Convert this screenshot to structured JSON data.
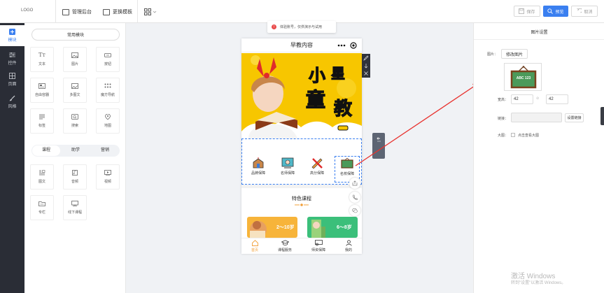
{
  "topbar": {
    "logo": "LOGO",
    "nav": [
      {
        "label": "管理后台",
        "icon": "monitor-icon"
      },
      {
        "label": "更换模板",
        "icon": "template-icon"
      }
    ],
    "grid_icon": "grid-icon",
    "buttons": {
      "save": "保存",
      "preview": "预览",
      "cancel": "取消"
    }
  },
  "leftbar": {
    "items": [
      {
        "label": "模块",
        "icon": "plus-square-icon",
        "active": true
      },
      {
        "label": "控件",
        "icon": "sliders-icon"
      },
      {
        "label": "页面",
        "icon": "pages-icon"
      },
      {
        "label": "风格",
        "icon": "brush-icon"
      }
    ]
  },
  "modules": {
    "common_title": "常用模块",
    "common": [
      {
        "label": "文本",
        "icon": "text-icon"
      },
      {
        "label": "图片",
        "icon": "image-icon"
      },
      {
        "label": "按钮",
        "icon": "button-icon"
      },
      {
        "label": "自由容器",
        "icon": "container-icon"
      },
      {
        "label": "多图文",
        "icon": "multi-image-icon"
      },
      {
        "label": "魔方导航",
        "icon": "cube-nav-icon"
      },
      {
        "label": "标签",
        "icon": "tag-icon"
      },
      {
        "label": "搜索",
        "icon": "search-icon"
      },
      {
        "label": "地图",
        "icon": "map-pin-icon"
      }
    ],
    "tabs": [
      "课程",
      "助学",
      "营销"
    ],
    "course": [
      {
        "label": "图文",
        "icon": "article-icon"
      },
      {
        "label": "音频",
        "icon": "audio-icon"
      },
      {
        "label": "视频",
        "icon": "video-icon"
      },
      {
        "label": "专栏",
        "icon": "column-icon"
      },
      {
        "label": "线下课程",
        "icon": "offline-course-icon"
      }
    ]
  },
  "notice": {
    "text": "体验账号，仅供演示与试用",
    "icon": "!"
  },
  "phone": {
    "title": "早教内容",
    "banner_text": "小童星教",
    "icons": [
      {
        "label": "品牌保障",
        "icon": "school-icon"
      },
      {
        "label": "名师保障",
        "icon": "teacher-icon"
      },
      {
        "label": "高分保障",
        "icon": "pencil-ruler-icon"
      },
      {
        "label": "名校保障",
        "icon": "abc-board-icon"
      }
    ],
    "section_title": "特色课程",
    "cards": [
      {
        "age": "2～10岁"
      },
      {
        "age": "6～8岁"
      }
    ],
    "tabbar": [
      {
        "label": "首页",
        "icon": "home-icon",
        "active": true
      },
      {
        "label": "课程服务",
        "icon": "graduation-icon"
      },
      {
        "label": "师资保障",
        "icon": "certificate-icon"
      },
      {
        "label": "我的",
        "icon": "user-icon"
      }
    ]
  },
  "settings": {
    "title": "图片设置",
    "image_label": "图片：",
    "change_image": "修改图片",
    "size_label": "宽高：",
    "width": "42",
    "height": "42",
    "link_label": "链接：",
    "link_value": "",
    "set_link": "设置链接",
    "large_label": "大图：",
    "large_option": "点击查看大图",
    "board_text": "ABC 123"
  },
  "watermark": {
    "line1": "激活 Windows",
    "line2": "转到\"设置\"以激活 Windows。"
  },
  "colors": {
    "accent": "#3a7ff0",
    "dark": "#2a2d36",
    "banner": "#f7c600",
    "annotation": "#e8332f"
  }
}
